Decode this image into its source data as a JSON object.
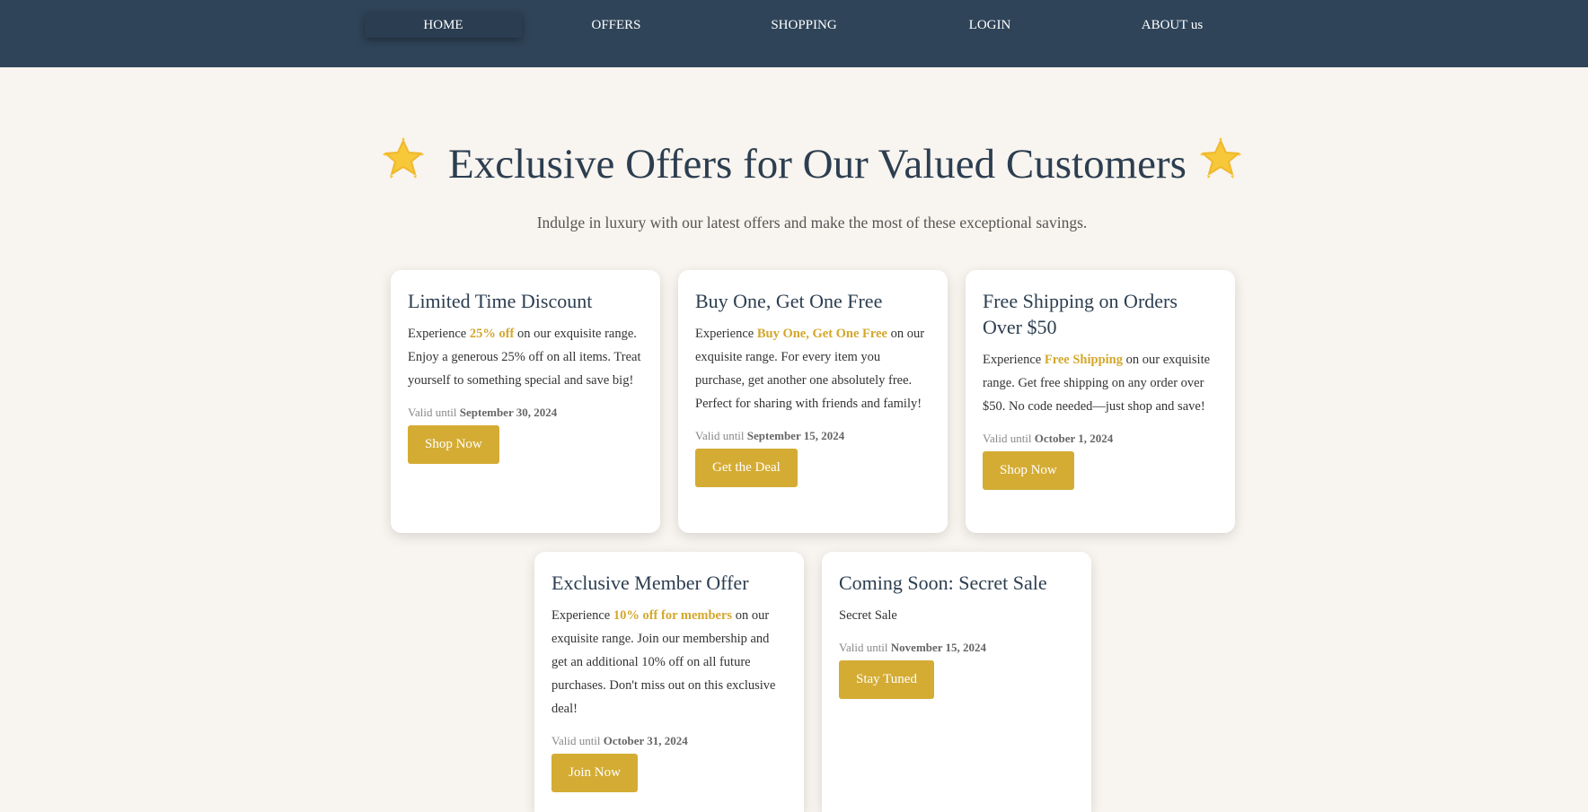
{
  "nav": {
    "items": [
      {
        "label": "HOME",
        "active": true
      },
      {
        "label": "OFFERS",
        "active": false
      },
      {
        "label": "SHOPPING",
        "active": false
      },
      {
        "label": "LOGIN",
        "active": false
      },
      {
        "label": "ABOUT us",
        "active": false
      }
    ]
  },
  "hero": {
    "title": "Exclusive Offers for Our Valued Customers",
    "subtitle": "Indulge in luxury with our latest offers and make the most of these exceptional savings.",
    "decoration_icon": "glowing-star-icon"
  },
  "offers": [
    {
      "title": "Limited Time Discount",
      "desc_prefix": "Experience ",
      "highlight": "25% off",
      "desc_suffix": " on our exquisite range. Enjoy a generous 25% off on all items. Treat yourself to something special and save big!",
      "valid_label": "Valid until ",
      "valid_date": "September 30, 2024",
      "button": "Shop Now"
    },
    {
      "title": "Buy One, Get One Free",
      "desc_prefix": "Experience ",
      "highlight": "Buy One, Get One Free",
      "desc_suffix": " on our exquisite range. For every item you purchase, get another one absolutely free. Perfect for sharing with friends and family!",
      "valid_label": "Valid until ",
      "valid_date": "September 15, 2024",
      "button": "Get the Deal"
    },
    {
      "title": "Free Shipping on Orders Over $50",
      "desc_prefix": "Experience ",
      "highlight": "Free Shipping",
      "desc_suffix": " on our exquisite range. Get free shipping on any order over $50. No code needed—just shop and save!",
      "valid_label": "Valid until ",
      "valid_date": "October 1, 2024",
      "button": "Shop Now"
    },
    {
      "title": "Exclusive Member Offer",
      "desc_prefix": "Experience ",
      "highlight": "10% off for members",
      "desc_suffix": " on our exquisite range. Join our membership and get an additional 10% off on all future purchases. Don't miss out on this exclusive deal!",
      "valid_label": "Valid until ",
      "valid_date": "October 31, 2024",
      "button": "Join Now"
    },
    {
      "title": "Coming Soon: Secret Sale",
      "desc_prefix": "Secret Sale",
      "highlight": "",
      "desc_suffix": "",
      "valid_label": "Valid until ",
      "valid_date": "November 15, 2024",
      "button": "Stay Tuned"
    }
  ],
  "colors": {
    "nav_bg": "#2f4459",
    "page_bg": "#f8f4ef",
    "accent": "#d4ac34",
    "heading": "#2c3e50"
  }
}
